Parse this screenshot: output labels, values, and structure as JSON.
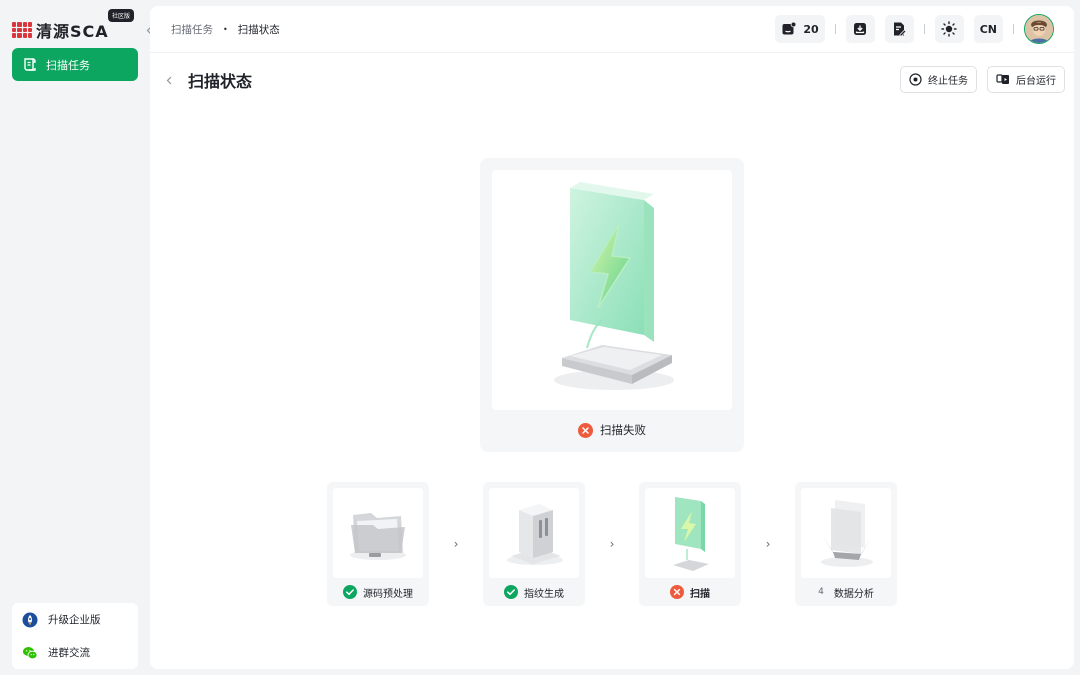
{
  "sidebar": {
    "logo_text": "清源SCA",
    "edition_badge": "社区版",
    "nav": [
      {
        "label": "扫描任务",
        "icon": "scroll-icon",
        "active": true
      }
    ],
    "bottom": [
      {
        "label": "升级企业版",
        "icon": "rocket-icon"
      },
      {
        "label": "进群交流",
        "icon": "wechat-icon"
      }
    ]
  },
  "breadcrumb": {
    "parent": "扫描任务",
    "separator": "•",
    "current": "扫描状态"
  },
  "toolbar": {
    "notifications_count": "20",
    "language": "CN",
    "icons": [
      "message-badge-icon",
      "download-box-icon",
      "document-edit-icon",
      "sun-icon"
    ]
  },
  "page": {
    "title": "扫描状态",
    "actions": {
      "stop": "终止任务",
      "background": "后台运行"
    }
  },
  "status": {
    "label": "扫描失败",
    "state": "failed"
  },
  "steps": [
    {
      "label": "源码预处理",
      "state": "success",
      "number": ""
    },
    {
      "label": "指纹生成",
      "state": "success",
      "number": ""
    },
    {
      "label": "扫描",
      "state": "failed",
      "number": ""
    },
    {
      "label": "数据分析",
      "state": "pending",
      "number": "4"
    }
  ],
  "colors": {
    "accent": "#0ca660",
    "error": "#f05a3c",
    "page_bg": "#f2f4f5"
  }
}
